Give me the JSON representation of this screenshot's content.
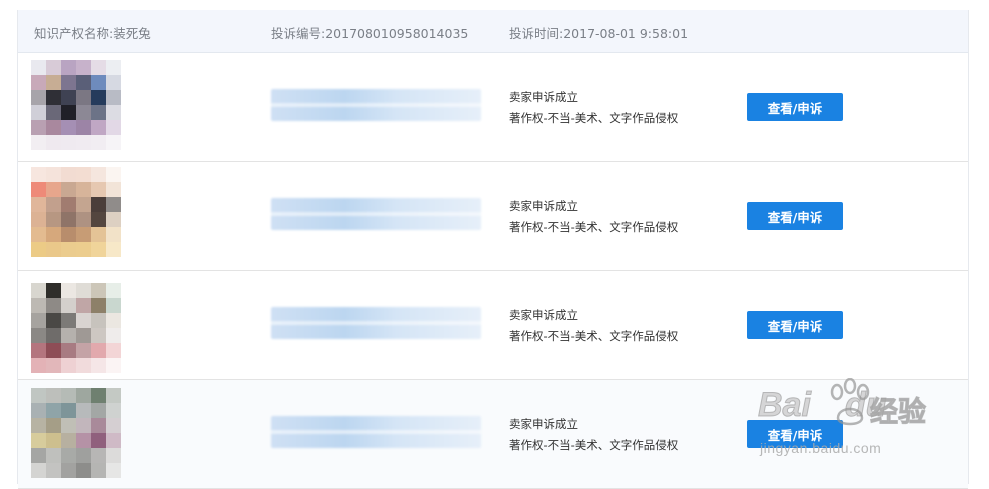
{
  "header": {
    "ip_name": "知识产权名称:装死兔",
    "complaint_no": "投诉编号:201708010958014035",
    "complaint_time": "投诉时间:2017-08-01 9:58:01"
  },
  "rows": [
    {
      "status": "卖家申诉成立",
      "type": "著作权-不当-美术、文字作品侵权",
      "action": "查看/申诉"
    },
    {
      "status": "卖家申诉成立",
      "type": "著作权-不当-美术、文字作品侵权",
      "action": "查看/申诉"
    },
    {
      "status": "卖家申诉成立",
      "type": "著作权-不当-美术、文字作品侵权",
      "action": "查看/申诉"
    },
    {
      "status": "卖家申诉成立",
      "type": "著作权-不当-美术、文字作品侵权",
      "action": "查看/申诉"
    }
  ],
  "watermark": {
    "logo": "Bai",
    "logo_suffix": "du",
    "cn": "经验",
    "url": "jingyan.baidu.com"
  },
  "colors": {
    "accent": "#1a82e2",
    "header_bg": "#f3f6fc",
    "header_text": "#7a7f87",
    "border": "#e3e3e3"
  }
}
